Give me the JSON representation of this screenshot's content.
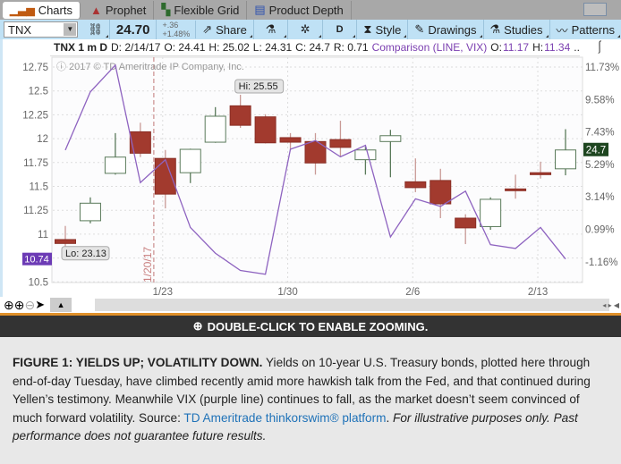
{
  "tabs": [
    {
      "label": "Charts",
      "icon": "bar-chart-icon"
    },
    {
      "label": "Prophet",
      "icon": "prophet-icon"
    },
    {
      "label": "Flexible Grid",
      "icon": "grid-icon"
    },
    {
      "label": "Product Depth",
      "icon": "depth-icon"
    }
  ],
  "toolbar": {
    "symbol": "TNX",
    "last": "24.70",
    "change": "+.36",
    "change_pct": "+1.48%",
    "share": "Share",
    "period": "D",
    "style": "Style",
    "drawings": "Drawings",
    "studies": "Studies",
    "patterns": "Patterns"
  },
  "header": {
    "title": "TNX 1 m D",
    "d": "D: 2/14/17",
    "o": "O: 24.41",
    "h": "H: 25.02",
    "l": "L: 24.31",
    "c": "C: 24.7",
    "r": "R: 0.71",
    "comparison": "Comparison (LINE, VIX)",
    "co_label": "O:",
    "co": "11.17",
    "ch_label": "H:",
    "ch": "11.34",
    "more": "..."
  },
  "colors": {
    "up": "#5a7a5a",
    "down": "#a23a2e",
    "vix": "#8e63c0",
    "last_bg": "#1e4620",
    "vix_bg": "#6c3bb5"
  },
  "chart_data": {
    "type": "candlestick+line",
    "copyright": "2017 © TD Ameritrade IP Company, Inc.",
    "x_ticks": [
      {
        "index": 4,
        "label": "1/23"
      },
      {
        "index": 9,
        "label": "1/30"
      },
      {
        "index": 14,
        "label": "2/6"
      },
      {
        "index": 19,
        "label": "2/13"
      }
    ],
    "event_marker": {
      "index": 3,
      "label": "1/20/17"
    },
    "left_axis": {
      "ticks": [
        "12.75",
        "12.5",
        "12.25",
        "12",
        "11.75",
        "11.5",
        "11.25",
        "11",
        "10.75",
        "10.5"
      ],
      "range": [
        10.5,
        12.75
      ],
      "current": "10.74"
    },
    "right_axis": {
      "ticks": [
        "11.73%",
        "9.58%",
        "7.43%",
        "5.29%",
        "3.14%",
        "0.99%",
        "-1.16%"
      ],
      "current": "24.7"
    },
    "hi_label": "Hi: 25.55",
    "lo_label": "Lo: 23.13",
    "candles": [
      {
        "o": 23.32,
        "h": 23.53,
        "l": 23.13,
        "c": 23.26
      },
      {
        "o": 23.61,
        "h": 23.97,
        "l": 23.57,
        "c": 23.88
      },
      {
        "o": 24.34,
        "h": 24.96,
        "l": 24.32,
        "c": 24.59
      },
      {
        "o": 24.98,
        "h": 25.12,
        "l": 24.59,
        "c": 24.65
      },
      {
        "o": 24.57,
        "h": 24.7,
        "l": 23.8,
        "c": 24.02
      },
      {
        "o": 24.35,
        "h": 24.72,
        "l": 24.19,
        "c": 24.71
      },
      {
        "o": 24.82,
        "h": 25.36,
        "l": 24.81,
        "c": 25.22
      },
      {
        "o": 25.38,
        "h": 25.55,
        "l": 25.04,
        "c": 25.08
      },
      {
        "o": 25.21,
        "h": 25.25,
        "l": 24.8,
        "c": 24.81
      },
      {
        "o": 24.89,
        "h": 24.96,
        "l": 24.7,
        "c": 24.82
      },
      {
        "o": 24.83,
        "h": 24.96,
        "l": 24.32,
        "c": 24.5
      },
      {
        "o": 24.86,
        "h": 25.15,
        "l": 24.6,
        "c": 24.74
      },
      {
        "o": 24.55,
        "h": 24.75,
        "l": 24.32,
        "c": 24.7
      },
      {
        "o": 24.83,
        "h": 25.01,
        "l": 24.28,
        "c": 24.92
      },
      {
        "o": 24.21,
        "h": 24.57,
        "l": 24.05,
        "c": 24.12
      },
      {
        "o": 24.23,
        "h": 24.41,
        "l": 23.65,
        "c": 23.87
      },
      {
        "o": 23.65,
        "h": 23.71,
        "l": 23.25,
        "c": 23.5
      },
      {
        "o": 23.52,
        "h": 23.97,
        "l": 23.47,
        "c": 23.94
      },
      {
        "o": 24.1,
        "h": 24.32,
        "l": 23.95,
        "c": 24.08
      },
      {
        "o": 24.35,
        "h": 24.52,
        "l": 24.26,
        "c": 24.32
      },
      {
        "o": 24.41,
        "h": 25.02,
        "l": 24.31,
        "c": 24.7
      }
    ],
    "vix": [
      11.88,
      12.49,
      12.77,
      11.54,
      11.78,
      11.07,
      10.8,
      10.62,
      10.58,
      11.89,
      11.98,
      11.81,
      11.93,
      10.97,
      11.37,
      11.29,
      11.45,
      10.89,
      10.85,
      11.07,
      10.74
    ]
  },
  "banner": "DOUBLE-CLICK TO ENABLE ZOOMING.",
  "caption": {
    "bold": "FIGURE 1: YIELDS UP; VOLATILITY DOWN.",
    "text": " Yields on 10-year U.S. Treasury bonds, plotted here through end-of-day Tuesday, have climbed recently amid more hawkish talk from the Fed, and that continued during Yellen’s testimony. Meanwhile VIX (purple line) continues to fall, as the market doesn’t seem convinced of much forward volatility. Source: ",
    "link": "TD Ameritrade thinkorswim® platform",
    "tail": ". ",
    "italic": "For illustrative purposes only. Past performance does not guarantee future results."
  }
}
